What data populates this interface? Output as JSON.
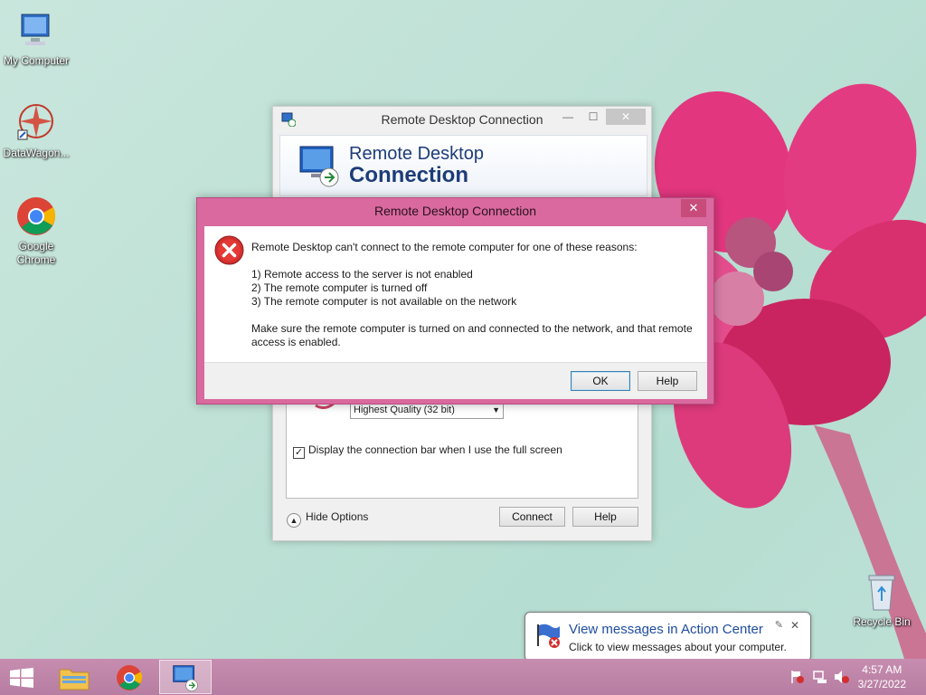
{
  "desktop": {
    "icons": [
      {
        "label": "My Computer"
      },
      {
        "label": "DataWagon..."
      },
      {
        "label": "Google Chrome"
      },
      {
        "label": "Recycle Bin"
      }
    ]
  },
  "rdc_window": {
    "title": "Remote Desktop Connection",
    "banner_line1": "Remote Desktop",
    "banner_line2": "Connection",
    "color_depth_value": "Highest Quality (32 bit)",
    "checkbox_label": "Display the connection bar when I use the full screen",
    "checkbox_checked": true,
    "hide_options_label": "Hide Options",
    "connect_label": "Connect",
    "help_label": "Help",
    "minimize": "—",
    "maximize": "☐",
    "close": "✕"
  },
  "error_dialog": {
    "title": "Remote Desktop Connection",
    "close": "✕",
    "intro": "Remote Desktop can't connect to the remote computer for one of these reasons:",
    "reasons": [
      "1) Remote access to the server is not enabled",
      "2) The remote computer is turned off",
      "3) The remote computer is not available on the network"
    ],
    "footer_text": "Make sure the remote computer is turned on and connected to the network, and that remote access is enabled.",
    "ok_label": "OK",
    "help_label": "Help"
  },
  "notification": {
    "title": "View messages in Action Center",
    "subtitle": "Click to view messages about your computer.",
    "close": "✕",
    "pin": "✎"
  },
  "taskbar": {
    "clock_time": "4:57 AM",
    "clock_date": "3/27/2022"
  },
  "colors": {
    "accent": "#d9699e",
    "taskbar": "#b77da2",
    "title_text": "#1d3c78"
  }
}
